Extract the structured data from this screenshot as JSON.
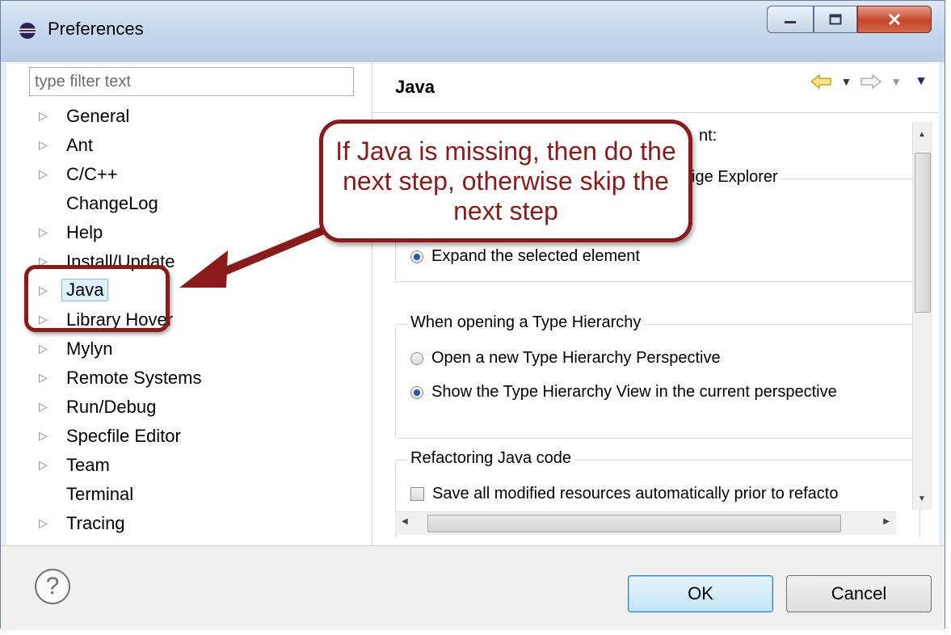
{
  "window": {
    "title": "Preferences"
  },
  "filter": {
    "placeholder": "type filter text"
  },
  "tree": {
    "items": [
      {
        "label": "General",
        "expandable": true
      },
      {
        "label": "Ant",
        "expandable": true
      },
      {
        "label": "C/C++",
        "expandable": true
      },
      {
        "label": "ChangeLog",
        "expandable": false
      },
      {
        "label": "Help",
        "expandable": true
      },
      {
        "label": "Install/Update",
        "expandable": true
      },
      {
        "label": "Java",
        "expandable": true,
        "selected": true
      },
      {
        "label": "Library Hover",
        "expandable": true
      },
      {
        "label": "Mylyn",
        "expandable": true
      },
      {
        "label": "Remote Systems",
        "expandable": true
      },
      {
        "label": "Run/Debug",
        "expandable": true
      },
      {
        "label": "Specfile Editor",
        "expandable": true
      },
      {
        "label": "Team",
        "expandable": true
      },
      {
        "label": "Terminal",
        "expandable": false
      },
      {
        "label": "Tracing",
        "expandable": true
      }
    ]
  },
  "page": {
    "title": "Java",
    "partial_text_1": "nt:",
    "partial_text_2": "ige Explorer",
    "expand_option": "Expand the selected element",
    "type_hierarchy": {
      "title": "When opening a Type Hierarchy",
      "option1": "Open a new Type Hierarchy Perspective",
      "option2": "Show the Type Hierarchy View in the current perspective"
    },
    "refactoring": {
      "title": "Refactoring Java code",
      "option": "Save all modified resources automatically prior to refacto"
    }
  },
  "buttons": {
    "ok": "OK",
    "cancel": "Cancel",
    "help": "?"
  },
  "callout": {
    "text": "If Java is missing, then do the next step, otherwise skip the next step"
  },
  "colors": {
    "annotation": "#8b1a1a",
    "radio_selected": "#2c5aa7",
    "title_bar": "#c7d9ee"
  }
}
